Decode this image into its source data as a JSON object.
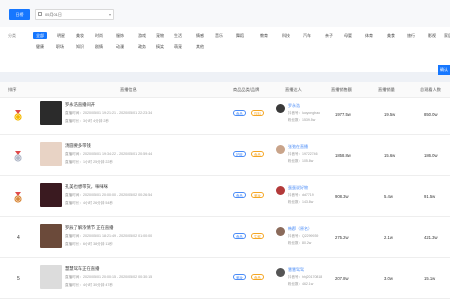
{
  "toolbar": {
    "day_label": "日榜",
    "date_value": "05月01日"
  },
  "categories": {
    "label": "分类",
    "row1": [
      "全部",
      "明星",
      "美妆",
      "时尚",
      "服饰",
      "游戏",
      "宠物",
      "生活",
      "情感",
      "音乐",
      "舞蹈",
      "教育",
      "科技",
      "汽车",
      "亲子",
      "母婴",
      "体育",
      "美食",
      "旅行",
      "影视",
      "家居"
    ],
    "row2": [
      "健康",
      "职场",
      "知识",
      "剧情",
      "动漫",
      "政务",
      "搞笑",
      "萌宠",
      "其他"
    ],
    "more_label": "确认"
  },
  "table": {
    "headers": [
      "排序",
      "直播信息",
      "商品品类/品牌",
      "直播达人",
      "直播销售额",
      "直播销量",
      "总观看人数"
    ],
    "rows": [
      {
        "rank": "1",
        "title": "罗永浩直播间开",
        "time": "直播时间：2020/05/01 19:21:21 - 2020/05/01 22:23:34",
        "meta": "直播时长：3小时 4分钟 2秒",
        "tags": [
          "食品",
          "饮料"
        ],
        "anchor": "罗永浩",
        "anchor_id": "抖音号：luoyonghao",
        "fans": "粉丝数：1539.5w",
        "sales": "1977.5w",
        "volume": "19.5w",
        "viewers": "850.0w"
      },
      {
        "rank": "2",
        "title": "汤圆要多带钱",
        "time": "直播时间：2020/05/01 19:34:22 - 2020/05/01 20:59:44",
        "meta": "直播时长：1小时 25分钟 22秒",
        "tags": [
          "护肤",
          "食品"
        ],
        "anchor": "张弛在直播",
        "anchor_id": "抖音号：19722746",
        "fans": "粉丝数：105.8w",
        "sales": "1858.8w",
        "volume": "15.6w",
        "viewers": "186.0w"
      },
      {
        "rank": "3",
        "title": "孔美也想带货，咪咪咪",
        "time": "直播时间：2020/05/01 20:00:00 - 2020/05/02 00:26:54",
        "meta": "直播时长：4小时 26分钟 54秒",
        "tags": [
          "食品",
          "美妆"
        ],
        "anchor": "蛋蛋说好物",
        "anchor_id": "抖音号：dd7719",
        "fans": "粉丝数：143.8w",
        "sales": "908.3w",
        "volume": "5.4w",
        "viewers": "91.5w"
      },
      {
        "rank": "4",
        "title": "罗辰了解浓情节 正在直播",
        "time": "直播时间：2020/05/01 18:21:49 - 2020/05/02 01:00:00",
        "meta": "直播时长：6小时 38分钟 11秒",
        "tags": [
          "食品",
          "生鲜"
        ],
        "anchor": "韩郡（原名）",
        "anchor_id": "抖音号：Q2299939",
        "fans": "粉丝数：80.2w",
        "sales": "275.2w",
        "volume": "2.1w",
        "viewers": "421.3w"
      },
      {
        "rank": "5",
        "title": "慧慧驾车正在直播",
        "time": "直播时间：2020/05/01 20:00:15 - 2020/05/02 00:30:15",
        "meta": "直播时长：4小时 30分钟 47秒",
        "tags": [
          "美妆",
          "食品"
        ],
        "anchor": "慧慧驾驾",
        "anchor_id": "抖音号：hhj20170818",
        "fans": "粉丝数：462.1w",
        "sales": "207.8w",
        "volume": "3.0w",
        "viewers": "15.1w"
      }
    ]
  }
}
